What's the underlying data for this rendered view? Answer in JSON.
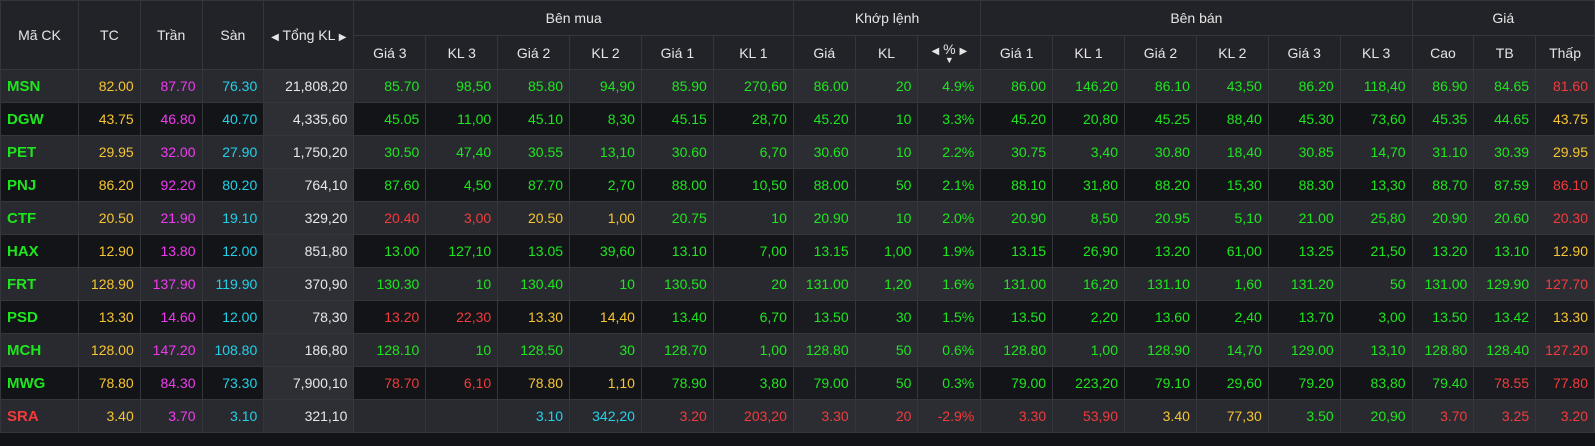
{
  "header": {
    "symbol": "Mã CK",
    "tc": "TC",
    "tran": "Trần",
    "san": "Sàn",
    "total_vol": "Tổng KL",
    "buy_group": "Bên mua",
    "match_group": "Khớp lệnh",
    "sell_group": "Bên bán",
    "price_group": "Giá",
    "buy_cols": [
      "Giá 3",
      "KL 3",
      "Giá 2",
      "KL 2",
      "Giá 1",
      "KL 1"
    ],
    "match_cols": [
      "Giá",
      "KL",
      "%"
    ],
    "sell_cols": [
      "Giá 1",
      "KL 1",
      "Giá 2",
      "KL 2",
      "Giá 3",
      "KL 3"
    ],
    "price_cols": [
      "Cao",
      "TB",
      "Thấp"
    ]
  },
  "icons": {
    "left": "◀",
    "right": "▶",
    "down": "▼"
  },
  "colors": {
    "up": "#1ee61e",
    "down": "#f23b3b",
    "ref": "#f6c531",
    "ceiling": "#f23af2",
    "floor": "#22d1e8"
  },
  "rows": [
    {
      "symbol": "MSN",
      "sc": "green",
      "tc": "82.00",
      "tran": "87.70",
      "san": "76.30",
      "total": "21,808,20",
      "buy": [
        [
          "85.70",
          "green"
        ],
        [
          "98,50",
          "green"
        ],
        [
          "85.80",
          "green"
        ],
        [
          "94,90",
          "green"
        ],
        [
          "85.90",
          "green"
        ],
        [
          "270,60",
          "green"
        ]
      ],
      "match": [
        [
          "86.00",
          "green"
        ],
        [
          "20",
          "green"
        ],
        [
          "4.9%",
          "green"
        ]
      ],
      "sell": [
        [
          "86.00",
          "green"
        ],
        [
          "146,20",
          "green"
        ],
        [
          "86.10",
          "green"
        ],
        [
          "43,50",
          "green"
        ],
        [
          "86.20",
          "green"
        ],
        [
          "118,40",
          "green"
        ]
      ],
      "price": [
        [
          "86.90",
          "green"
        ],
        [
          "84.65",
          "green"
        ],
        [
          "81.60",
          "red"
        ]
      ]
    },
    {
      "symbol": "DGW",
      "sc": "green",
      "tc": "43.75",
      "tran": "46.80",
      "san": "40.70",
      "total": "4,335,60",
      "buy": [
        [
          "45.05",
          "green"
        ],
        [
          "11,00",
          "green"
        ],
        [
          "45.10",
          "green"
        ],
        [
          "8,30",
          "green"
        ],
        [
          "45.15",
          "green"
        ],
        [
          "28,70",
          "green"
        ]
      ],
      "match": [
        [
          "45.20",
          "green"
        ],
        [
          "10",
          "green"
        ],
        [
          "3.3%",
          "green"
        ]
      ],
      "sell": [
        [
          "45.20",
          "green"
        ],
        [
          "20,80",
          "green"
        ],
        [
          "45.25",
          "green"
        ],
        [
          "88,40",
          "green"
        ],
        [
          "45.30",
          "green"
        ],
        [
          "73,60",
          "green"
        ]
      ],
      "price": [
        [
          "45.35",
          "green"
        ],
        [
          "44.65",
          "green"
        ],
        [
          "43.75",
          "yellow"
        ]
      ]
    },
    {
      "symbol": "PET",
      "sc": "green",
      "tc": "29.95",
      "tran": "32.00",
      "san": "27.90",
      "total": "1,750,20",
      "buy": [
        [
          "30.50",
          "green"
        ],
        [
          "47,40",
          "green"
        ],
        [
          "30.55",
          "green"
        ],
        [
          "13,10",
          "green"
        ],
        [
          "30.60",
          "green"
        ],
        [
          "6,70",
          "green"
        ]
      ],
      "match": [
        [
          "30.60",
          "green"
        ],
        [
          "10",
          "green"
        ],
        [
          "2.2%",
          "green"
        ]
      ],
      "sell": [
        [
          "30.75",
          "green"
        ],
        [
          "3,40",
          "green"
        ],
        [
          "30.80",
          "green"
        ],
        [
          "18,40",
          "green"
        ],
        [
          "30.85",
          "green"
        ],
        [
          "14,70",
          "green"
        ]
      ],
      "price": [
        [
          "31.10",
          "green"
        ],
        [
          "30.39",
          "green"
        ],
        [
          "29.95",
          "yellow"
        ]
      ]
    },
    {
      "symbol": "PNJ",
      "sc": "green",
      "tc": "86.20",
      "tran": "92.20",
      "san": "80.20",
      "total": "764,10",
      "buy": [
        [
          "87.60",
          "green"
        ],
        [
          "4,50",
          "green"
        ],
        [
          "87.70",
          "green"
        ],
        [
          "2,70",
          "green"
        ],
        [
          "88.00",
          "green"
        ],
        [
          "10,50",
          "green"
        ]
      ],
      "match": [
        [
          "88.00",
          "green"
        ],
        [
          "50",
          "green"
        ],
        [
          "2.1%",
          "green"
        ]
      ],
      "sell": [
        [
          "88.10",
          "green"
        ],
        [
          "31,80",
          "green"
        ],
        [
          "88.20",
          "green"
        ],
        [
          "15,30",
          "green"
        ],
        [
          "88.30",
          "green"
        ],
        [
          "13,30",
          "green"
        ]
      ],
      "price": [
        [
          "88.70",
          "green"
        ],
        [
          "87.59",
          "green"
        ],
        [
          "86.10",
          "red"
        ]
      ]
    },
    {
      "symbol": "CTF",
      "sc": "green",
      "tc": "20.50",
      "tran": "21.90",
      "san": "19.10",
      "total": "329,20",
      "buy": [
        [
          "20.40",
          "red"
        ],
        [
          "3,00",
          "red"
        ],
        [
          "20.50",
          "yellow"
        ],
        [
          "1,00",
          "yellow"
        ],
        [
          "20.75",
          "green"
        ],
        [
          "10",
          "green"
        ]
      ],
      "match": [
        [
          "20.90",
          "green"
        ],
        [
          "10",
          "green"
        ],
        [
          "2.0%",
          "green"
        ]
      ],
      "sell": [
        [
          "20.90",
          "green"
        ],
        [
          "8,50",
          "green"
        ],
        [
          "20.95",
          "green"
        ],
        [
          "5,10",
          "green"
        ],
        [
          "21.00",
          "green"
        ],
        [
          "25,80",
          "green"
        ]
      ],
      "price": [
        [
          "20.90",
          "green"
        ],
        [
          "20.60",
          "green"
        ],
        [
          "20.30",
          "red"
        ]
      ]
    },
    {
      "symbol": "HAX",
      "sc": "green",
      "tc": "12.90",
      "tran": "13.80",
      "san": "12.00",
      "total": "851,80",
      "buy": [
        [
          "13.00",
          "green"
        ],
        [
          "127,10",
          "green"
        ],
        [
          "13.05",
          "green"
        ],
        [
          "39,60",
          "green"
        ],
        [
          "13.10",
          "green"
        ],
        [
          "7,00",
          "green"
        ]
      ],
      "match": [
        [
          "13.15",
          "green"
        ],
        [
          "1,00",
          "green"
        ],
        [
          "1.9%",
          "green"
        ]
      ],
      "sell": [
        [
          "13.15",
          "green"
        ],
        [
          "26,90",
          "green"
        ],
        [
          "13.20",
          "green"
        ],
        [
          "61,00",
          "green"
        ],
        [
          "13.25",
          "green"
        ],
        [
          "21,50",
          "green"
        ]
      ],
      "price": [
        [
          "13.20",
          "green"
        ],
        [
          "13.10",
          "green"
        ],
        [
          "12.90",
          "yellow"
        ]
      ]
    },
    {
      "symbol": "FRT",
      "sc": "green",
      "tc": "128.90",
      "tran": "137.90",
      "san": "119.90",
      "total": "370,90",
      "buy": [
        [
          "130.30",
          "green"
        ],
        [
          "10",
          "green"
        ],
        [
          "130.40",
          "green"
        ],
        [
          "10",
          "green"
        ],
        [
          "130.50",
          "green"
        ],
        [
          "20",
          "green"
        ]
      ],
      "match": [
        [
          "131.00",
          "green"
        ],
        [
          "1,20",
          "green"
        ],
        [
          "1.6%",
          "green"
        ]
      ],
      "sell": [
        [
          "131.00",
          "green"
        ],
        [
          "16,20",
          "green"
        ],
        [
          "131.10",
          "green"
        ],
        [
          "1,60",
          "green"
        ],
        [
          "131.20",
          "green"
        ],
        [
          "50",
          "green"
        ]
      ],
      "price": [
        [
          "131.00",
          "green"
        ],
        [
          "129.90",
          "green"
        ],
        [
          "127.70",
          "red"
        ]
      ]
    },
    {
      "symbol": "PSD",
      "sc": "green",
      "tc": "13.30",
      "tran": "14.60",
      "san": "12.00",
      "total": "78,30",
      "buy": [
        [
          "13.20",
          "red"
        ],
        [
          "22,30",
          "red"
        ],
        [
          "13.30",
          "yellow"
        ],
        [
          "14,40",
          "yellow"
        ],
        [
          "13.40",
          "green"
        ],
        [
          "6,70",
          "green"
        ]
      ],
      "match": [
        [
          "13.50",
          "green"
        ],
        [
          "30",
          "green"
        ],
        [
          "1.5%",
          "green"
        ]
      ],
      "sell": [
        [
          "13.50",
          "green"
        ],
        [
          "2,20",
          "green"
        ],
        [
          "13.60",
          "green"
        ],
        [
          "2,40",
          "green"
        ],
        [
          "13.70",
          "green"
        ],
        [
          "3,00",
          "green"
        ]
      ],
      "price": [
        [
          "13.50",
          "green"
        ],
        [
          "13.42",
          "green"
        ],
        [
          "13.30",
          "yellow"
        ]
      ]
    },
    {
      "symbol": "MCH",
      "sc": "green",
      "tc": "128.00",
      "tran": "147.20",
      "san": "108.80",
      "total": "186,80",
      "buy": [
        [
          "128.10",
          "green"
        ],
        [
          "10",
          "green"
        ],
        [
          "128.50",
          "green"
        ],
        [
          "30",
          "green"
        ],
        [
          "128.70",
          "green"
        ],
        [
          "1,00",
          "green"
        ]
      ],
      "match": [
        [
          "128.80",
          "green"
        ],
        [
          "50",
          "green"
        ],
        [
          "0.6%",
          "green"
        ]
      ],
      "sell": [
        [
          "128.80",
          "green"
        ],
        [
          "1,00",
          "green"
        ],
        [
          "128.90",
          "green"
        ],
        [
          "14,70",
          "green"
        ],
        [
          "129.00",
          "green"
        ],
        [
          "13,10",
          "green"
        ]
      ],
      "price": [
        [
          "128.80",
          "green"
        ],
        [
          "128.40",
          "green"
        ],
        [
          "127.20",
          "red"
        ]
      ]
    },
    {
      "symbol": "MWG",
      "sc": "green",
      "tc": "78.80",
      "tran": "84.30",
      "san": "73.30",
      "total": "7,900,10",
      "buy": [
        [
          "78.70",
          "red"
        ],
        [
          "6,10",
          "red"
        ],
        [
          "78.80",
          "yellow"
        ],
        [
          "1,10",
          "yellow"
        ],
        [
          "78.90",
          "green"
        ],
        [
          "3,80",
          "green"
        ]
      ],
      "match": [
        [
          "79.00",
          "green"
        ],
        [
          "50",
          "green"
        ],
        [
          "0.3%",
          "green"
        ]
      ],
      "sell": [
        [
          "79.00",
          "green"
        ],
        [
          "223,20",
          "green"
        ],
        [
          "79.10",
          "green"
        ],
        [
          "29,60",
          "green"
        ],
        [
          "79.20",
          "green"
        ],
        [
          "83,80",
          "green"
        ]
      ],
      "price": [
        [
          "79.40",
          "green"
        ],
        [
          "78.55",
          "red"
        ],
        [
          "77.80",
          "red"
        ]
      ]
    },
    {
      "symbol": "SRA",
      "sc": "red",
      "tc": "3.40",
      "tran": "3.70",
      "san": "3.10",
      "total": "321,10",
      "buy": [
        [
          "",
          ""
        ],
        [
          "",
          ""
        ],
        [
          "3.10",
          "cyan"
        ],
        [
          "342,20",
          "cyan"
        ],
        [
          "3.20",
          "red"
        ],
        [
          "203,20",
          "red"
        ]
      ],
      "match": [
        [
          "3.30",
          "red"
        ],
        [
          "20",
          "red"
        ],
        [
          "-2.9%",
          "red"
        ]
      ],
      "sell": [
        [
          "3.30",
          "red"
        ],
        [
          "53,90",
          "red"
        ],
        [
          "3.40",
          "yellow"
        ],
        [
          "77,30",
          "yellow"
        ],
        [
          "3.50",
          "green"
        ],
        [
          "20,90",
          "green"
        ]
      ],
      "price": [
        [
          "3.70",
          "red"
        ],
        [
          "3.25",
          "red"
        ],
        [
          "3.20",
          "red"
        ]
      ]
    }
  ]
}
